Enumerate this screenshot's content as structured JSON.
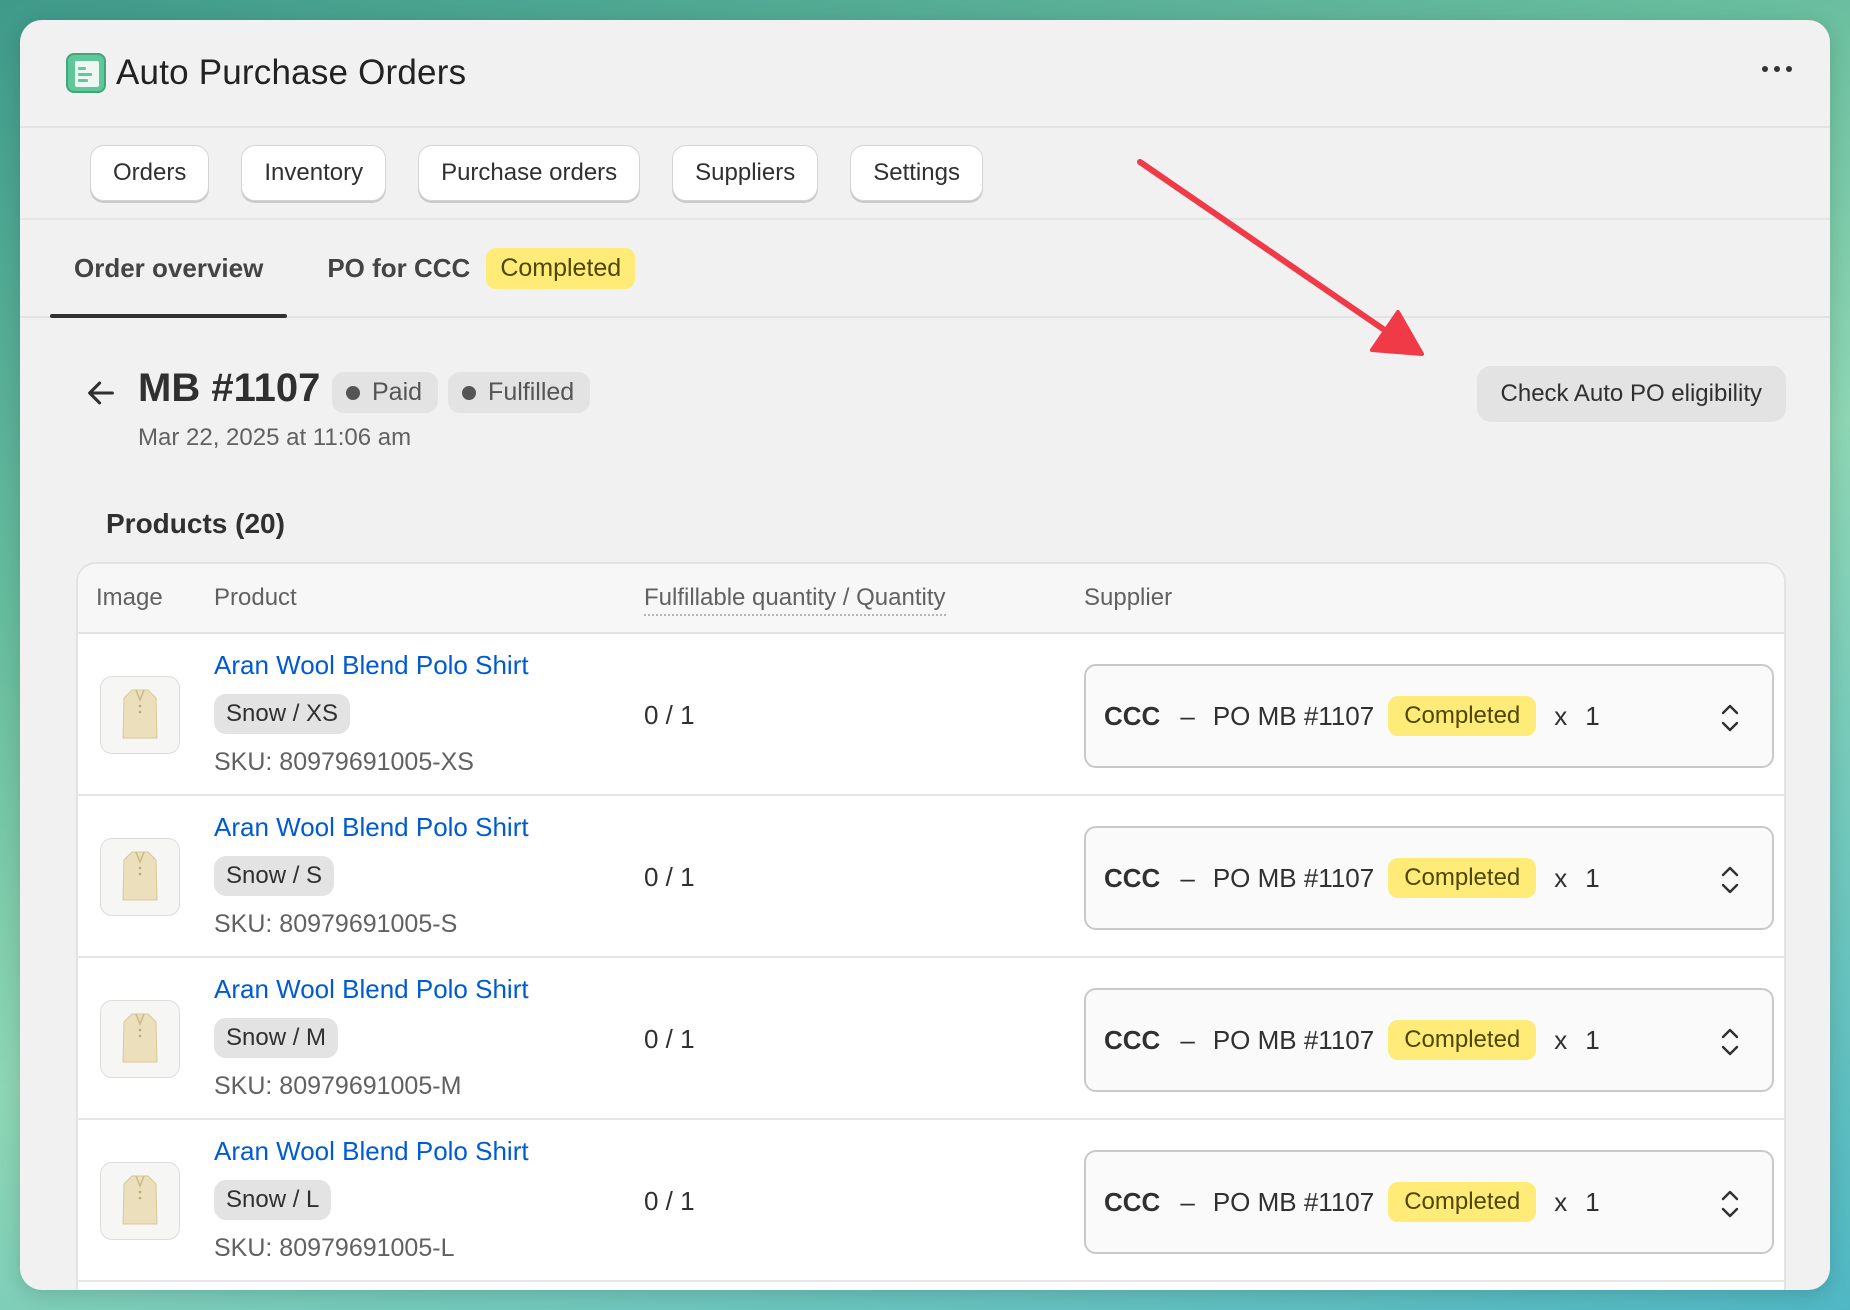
{
  "app": {
    "title": "Auto Purchase Orders"
  },
  "nav": {
    "items": [
      "Orders",
      "Inventory",
      "Purchase orders",
      "Suppliers",
      "Settings"
    ]
  },
  "tabs": {
    "order_overview": "Order overview",
    "po_tab": "PO for CCC",
    "po_status": "Completed"
  },
  "order": {
    "title": "MB #1107",
    "badges": [
      "Paid",
      "Fulfilled"
    ],
    "date": "Mar 22, 2025 at 11:06 am",
    "check_button": "Check Auto PO eligibility"
  },
  "products": {
    "title": "Products (20)",
    "columns": {
      "image": "Image",
      "product": "Product",
      "quantity": "Fulfillable quantity / Quantity",
      "supplier": "Supplier"
    },
    "rows": [
      {
        "name": "Aran Wool Blend Polo Shirt",
        "variant": "Snow / XS",
        "sku": "SKU: 80979691005-XS",
        "qty": "0 / 1",
        "supplier": "CCC",
        "dash": "–",
        "po": "PO MB #1107",
        "status": "Completed",
        "x": "x",
        "count": "1"
      },
      {
        "name": "Aran Wool Blend Polo Shirt",
        "variant": "Snow / S",
        "sku": "SKU: 80979691005-S",
        "qty": "0 / 1",
        "supplier": "CCC",
        "dash": "–",
        "po": "PO MB #1107",
        "status": "Completed",
        "x": "x",
        "count": "1"
      },
      {
        "name": "Aran Wool Blend Polo Shirt",
        "variant": "Snow / M",
        "sku": "SKU: 80979691005-M",
        "qty": "0 / 1",
        "supplier": "CCC",
        "dash": "–",
        "po": "PO MB #1107",
        "status": "Completed",
        "x": "x",
        "count": "1"
      },
      {
        "name": "Aran Wool Blend Polo Shirt",
        "variant": "Snow / L",
        "sku": "SKU: 80979691005-L",
        "qty": "0 / 1",
        "supplier": "CCC",
        "dash": "–",
        "po": "PO MB #1107",
        "status": "Completed",
        "x": "x",
        "count": "1"
      }
    ]
  },
  "colors": {
    "link": "#005bd3",
    "badge_yellow": "#ffeb78",
    "annotation_arrow": "#f03a47",
    "app_icon": "#5fc79a"
  },
  "icons": {
    "app": "spreadsheet-icon",
    "more": "more-horizontal-icon",
    "back": "arrow-left-icon",
    "select": "chevron-up-down-icon",
    "product_thumb": "shirt-icon"
  }
}
